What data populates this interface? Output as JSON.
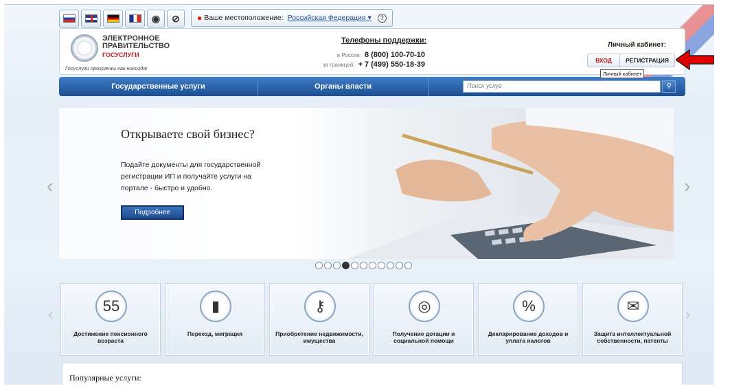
{
  "colors": {
    "accent": "#1d4f92",
    "brand_red": "#c02020",
    "arrow": "#e00000"
  },
  "lang_icons": [
    "flag-ru-icon",
    "flag-uk-icon",
    "flag-de-icon",
    "flag-fr-icon"
  ],
  "accessibility_icons": [
    "eye-icon",
    "compass-icon"
  ],
  "location": {
    "label": "Ваше местоположение:",
    "value": "Российская Федерация ▾",
    "help": "?"
  },
  "header": {
    "logo_title": "ЭЛЕКТРОННОЕ ПРАВИТЕЛЬСТВО",
    "logo_sub": "ГОСУСЛУГИ",
    "slogan": "Госуслуги прозрачны как никогда!",
    "support_title": "Телефоны поддержки:",
    "phones": [
      {
        "label": "в России:",
        "number": "8 (800) 100-70-10"
      },
      {
        "label": "за границей:",
        "number": "+ 7 (499) 550-18-39"
      }
    ],
    "account_title": "Личный кабинет:",
    "login": "ВХОД",
    "register": "РЕГИСТРАЦИЯ",
    "tooltip": "Личный кабинет"
  },
  "nav": {
    "items": [
      "Государственные услуги",
      "Органы власти"
    ],
    "search_placeholder": "Поиск услуг"
  },
  "banner": {
    "title": "Открываете свой бизнес?",
    "text": "Подайте документы для государственной регистрации ИП и получайте услуги на портале - быстро и удобно.",
    "button": "Подробнее",
    "slide_count": 11,
    "active_slide": 4
  },
  "tiles": [
    {
      "label": "Достижение пенсионного возраста",
      "icon": "calendar-55-icon",
      "glyph": "55"
    },
    {
      "label": "Переезд, миграция",
      "icon": "passport-icon",
      "glyph": "▮"
    },
    {
      "label": "Приобретение недвижимости, имущества",
      "icon": "keys-icon",
      "glyph": "⚷"
    },
    {
      "label": "Получение дотации и социальной помощи",
      "icon": "lifebuoy-icon",
      "glyph": "◎"
    },
    {
      "label": "Декларирование доходов и уплата налогов",
      "icon": "percent-icon",
      "glyph": "%"
    },
    {
      "label": "Защита интеллектуальной собственности, патенты",
      "icon": "certificate-icon",
      "glyph": "✉"
    }
  ],
  "popular": {
    "title": "Популярные услуги:"
  }
}
